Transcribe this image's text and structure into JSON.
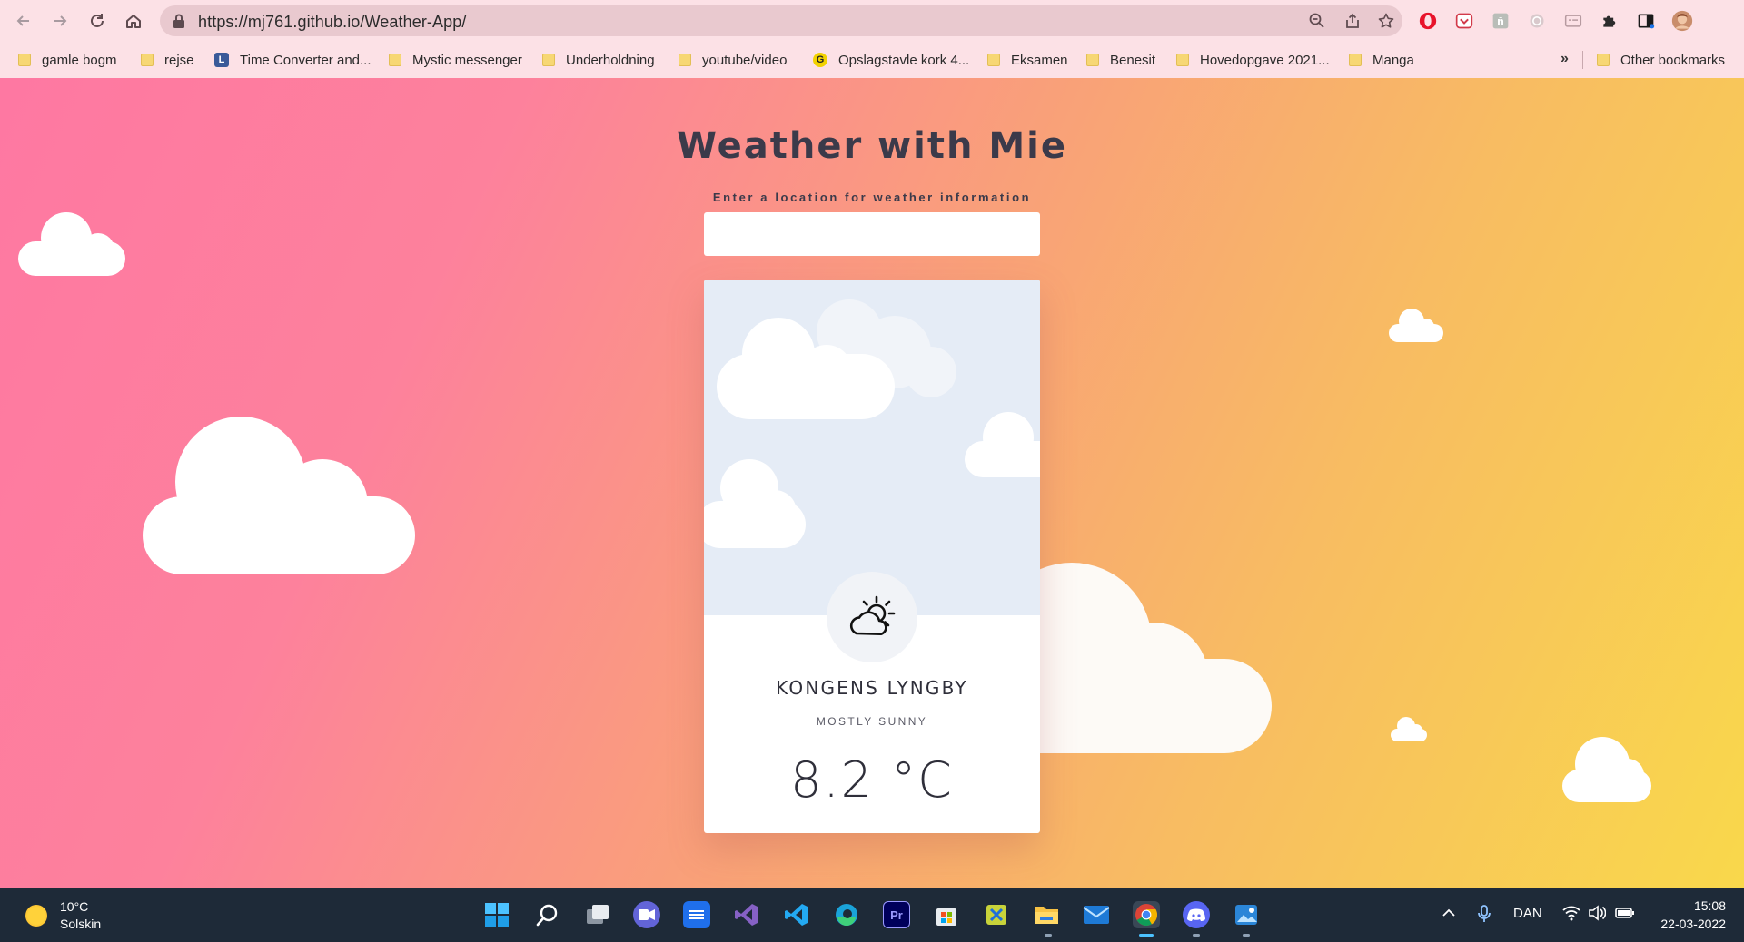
{
  "browser": {
    "url": "https://mj761.github.io/Weather-App/",
    "bookmarks": [
      {
        "label": "gamle bogm",
        "kind": "folder"
      },
      {
        "label": "rejse",
        "kind": "folder"
      },
      {
        "label": "Time Converter and...",
        "kind": "site"
      },
      {
        "label": "Mystic messenger",
        "kind": "folder"
      },
      {
        "label": "Underholdning",
        "kind": "folder"
      },
      {
        "label": "youtube/video",
        "kind": "folder"
      },
      {
        "label": "Opslagstavle kork 4...",
        "kind": "site"
      },
      {
        "label": "Eksamen",
        "kind": "folder"
      },
      {
        "label": "Benesit",
        "kind": "folder"
      },
      {
        "label": "Hovedopgave 2021...",
        "kind": "folder"
      },
      {
        "label": "Manga",
        "kind": "folder"
      }
    ],
    "overflow_label": "»",
    "other_bookmarks": "Other bookmarks"
  },
  "app": {
    "title": "Weather with Mie",
    "search_label": "Enter a location for weather information",
    "search_value": "",
    "location": "KONGENS LYNGBY",
    "conditions": "MOSTLY SUNNY",
    "temperature": "8.2 °C",
    "weather_icon": "partly-sunny-icon"
  },
  "taskbar": {
    "weather_temp": "10°C",
    "weather_desc": "Solskin",
    "language": "DAN",
    "time": "15:08",
    "date": "22-03-2022",
    "apps": [
      "windows-start",
      "search",
      "task-view",
      "teams-chat",
      "azure-data-studio",
      "visual-studio",
      "vs-code",
      "edge",
      "premiere-pro",
      "microsoft-store",
      "snipping-tool",
      "file-explorer",
      "mail",
      "chrome",
      "discord",
      "photos"
    ]
  },
  "colors": {
    "gradient_start": "#fe78a2",
    "gradient_end": "#f9d84b",
    "text_dark": "#3b3a4a",
    "card_sky": "#e5ecf6"
  }
}
